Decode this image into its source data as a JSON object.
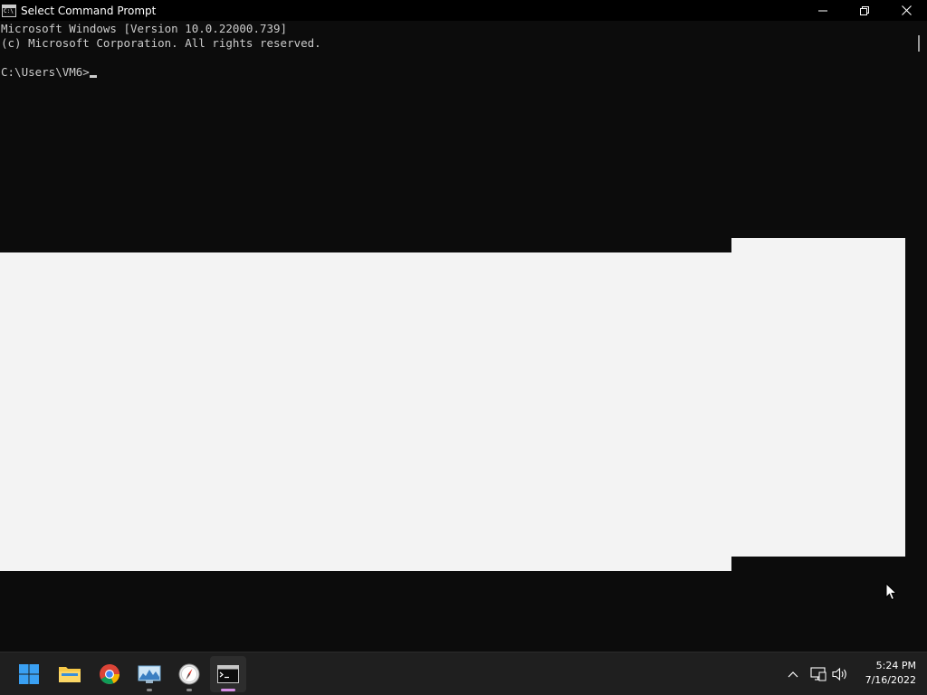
{
  "window": {
    "title": "Select Command Prompt",
    "app_icon_text": "C:\\",
    "controls": {
      "minimize": "minimize-icon",
      "maximize": "restore-icon",
      "close": "close-icon"
    }
  },
  "console": {
    "lines": [
      "Microsoft Windows [Version 10.0.22000.739]",
      "(c) Microsoft Corporation. All rights reserved.",
      ""
    ],
    "prompt": "C:\\Users\\VM6>"
  },
  "taskbar": {
    "apps": [
      {
        "name": "start",
        "icon": "windows-start-icon",
        "running": false,
        "active": false
      },
      {
        "name": "file-explorer",
        "icon": "folder-icon",
        "running": false,
        "active": false
      },
      {
        "name": "chrome",
        "icon": "chrome-icon",
        "running": false,
        "active": false
      },
      {
        "name": "resource-monitor",
        "icon": "monitor-chart-icon",
        "running": true,
        "active": false
      },
      {
        "name": "compass-app",
        "icon": "compass-icon",
        "running": true,
        "active": false
      },
      {
        "name": "command-prompt",
        "icon": "terminal-icon",
        "running": true,
        "active": true
      }
    ],
    "tray": {
      "icons": [
        "chevron-up-icon",
        "network-icon",
        "volume-icon"
      ]
    },
    "clock": {
      "time": "5:24 PM",
      "date": "7/16/2022"
    }
  },
  "colors": {
    "console_bg": "#0c0c0c",
    "console_text": "#cccccc",
    "titlebar_bg": "#000000",
    "selection_overlay": "#f3f3f3",
    "taskbar_bg": "#1f1f1f",
    "active_indicator": "#d58fe5"
  }
}
